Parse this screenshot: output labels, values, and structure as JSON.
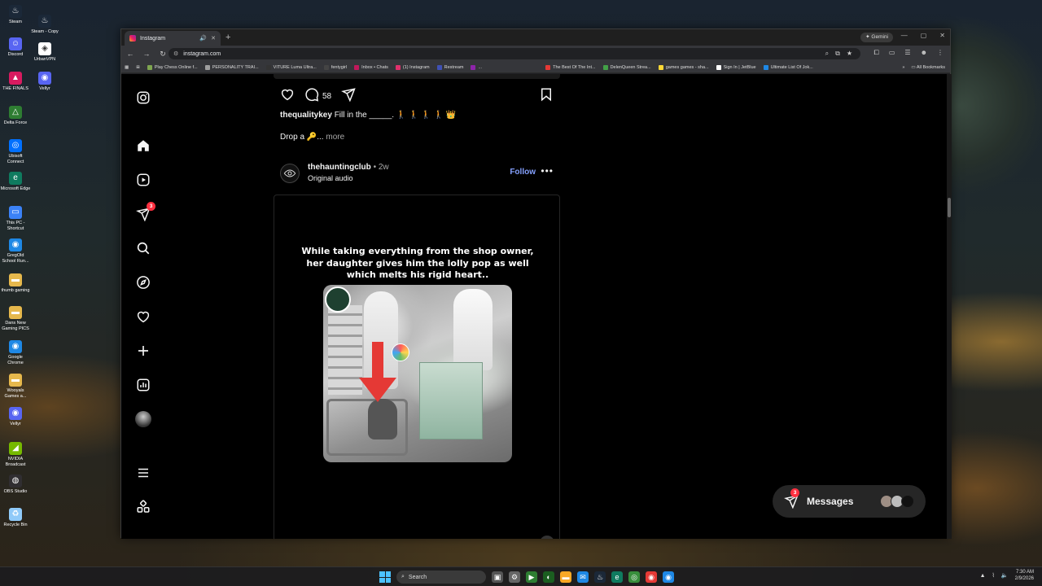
{
  "desktop": {
    "icons": [
      {
        "label": "Steam",
        "icon": "steam-icon",
        "color": "#1b2838"
      },
      {
        "label": "Steam - Copy",
        "icon": "steam-icon",
        "color": "#1b2838"
      },
      {
        "label": "Discord",
        "icon": "discord-icon",
        "color": "#5865f2"
      },
      {
        "label": "UrbanVPN",
        "icon": "vpn-icon",
        "color": "#ffffff"
      },
      {
        "label": "THE FINALS",
        "icon": "finals-icon",
        "color": "#d81b60"
      },
      {
        "label": "Vellyr",
        "icon": "vellyr-icon",
        "color": "#5865f2"
      },
      {
        "label": "Delta Force",
        "icon": "delta-force-icon",
        "color": "#2e7d32"
      },
      {
        "label": "Ubisoft Connect",
        "icon": "ubisoft-icon",
        "color": "#0070ff"
      },
      {
        "label": "Microsoft Edge",
        "icon": "edge-icon",
        "color": "#0f7b5f"
      },
      {
        "label": "This PC - Shortcut",
        "icon": "pc-icon",
        "color": "#3b82f6"
      },
      {
        "label": "GregOld School Run...",
        "icon": "chrome-icon",
        "color": "#1e88e5"
      },
      {
        "label": "thumb gaming",
        "icon": "folder-icon",
        "color": "#e6b84c"
      },
      {
        "label": "Dans New Gaming PICS",
        "icon": "folder-icon",
        "color": "#e6b84c"
      },
      {
        "label": "Google Chrome",
        "icon": "chrome-icon",
        "color": "#1e88e5"
      },
      {
        "label": "Wooyals Games a...",
        "icon": "folder-icon",
        "color": "#e6b84c"
      },
      {
        "label": "Vellyr",
        "icon": "vellyr-icon",
        "color": "#5865f2"
      },
      {
        "label": "NVIDIA Broadcast",
        "icon": "nvidia-icon",
        "color": "#76b900"
      },
      {
        "label": "OBS Studio",
        "icon": "obs-icon",
        "color": "#302e31"
      },
      {
        "label": "Recycle Bin",
        "icon": "recycle-bin-icon",
        "color": "#90caf9"
      }
    ]
  },
  "browser": {
    "tab": {
      "title": "Instagram",
      "audio_glyph": "🔊",
      "close_glyph": "✕"
    },
    "new_tab_glyph": "+",
    "gemini_label": "✦ Gemini",
    "url": "instagram.com",
    "bookmarks": [
      {
        "label": "Play Chess Online f...",
        "color": "#7fa650"
      },
      {
        "label": "PERSONALITY TRAI...",
        "color": "#9e9e9e"
      },
      {
        "label": "VITURE Luma Ultra...",
        "color": "#333333"
      },
      {
        "label": "fentygirl",
        "color": "#444444"
      },
      {
        "label": "Inbox • Chats",
        "color": "#c2185b"
      },
      {
        "label": "(1) Instagram",
        "color": "#e1306c"
      },
      {
        "label": "Restream",
        "color": "#3f51b5"
      },
      {
        "label": "...",
        "color": "#8e24aa"
      },
      {
        "label": "The Best Of The Int...",
        "color": "#e53935"
      },
      {
        "label": "DelenQueen Strea...",
        "color": "#43a047"
      },
      {
        "label": "games games - sha...",
        "color": "#fdd835"
      },
      {
        "label": "Sign In | JetBlue",
        "color": "#ffffff"
      },
      {
        "label": "Ultimate List Of Jok...",
        "color": "#1e88e5"
      }
    ],
    "bookmarks_more": "»",
    "all_bookmarks": "All Bookmarks"
  },
  "instagram": {
    "nav": {
      "notification_badge": "3"
    },
    "prev_post": {
      "comment_count": "58",
      "caption_user": "thequalitykey",
      "caption_text": "Fill in the _____. 🚶 🚶 🚶 🚶 👑",
      "caption_line2": "Drop a 🔑...",
      "more_label": "more"
    },
    "post": {
      "username": "thehauntingclub",
      "age": "• 2w",
      "audio": "Original audio",
      "follow_label": "Follow",
      "more_glyph": "•••",
      "overlay_text_1": "While taking everything from the shop owner,",
      "overlay_text_2": "her daughter gives him the lolly pop as well",
      "overlay_text_3": "which melts his rigid heart.."
    },
    "messages": {
      "label": "Messages",
      "badge": "3"
    }
  },
  "taskbar": {
    "search_placeholder": "Search",
    "time": "7:30 AM",
    "date": "2/9/2026"
  },
  "colors": {
    "ig_link": "#85a1ff",
    "ig_badge": "#ff3040",
    "page_bg": "#000000"
  }
}
